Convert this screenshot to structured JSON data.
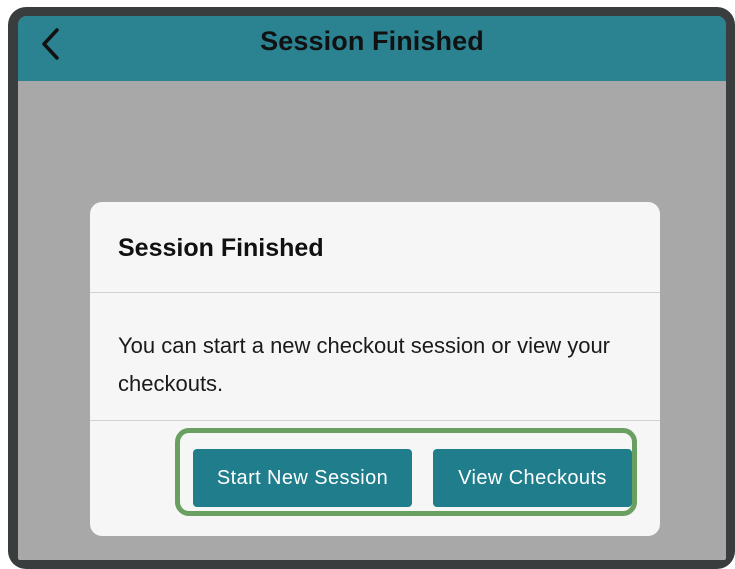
{
  "header": {
    "title": "Session Finished",
    "back_icon": "chevron-left-icon"
  },
  "dialog": {
    "title": "Session Finished",
    "message": "You can start a new checkout session or view your checkouts.",
    "buttons": {
      "start_new_session": "Start New Session",
      "view_checkouts": "View Checkouts"
    }
  },
  "colors": {
    "header_bg": "#2b8291",
    "button_bg": "#1f7d8c",
    "highlight_border": "#6a9f62",
    "overlay_bg": "#a8a8a8"
  }
}
